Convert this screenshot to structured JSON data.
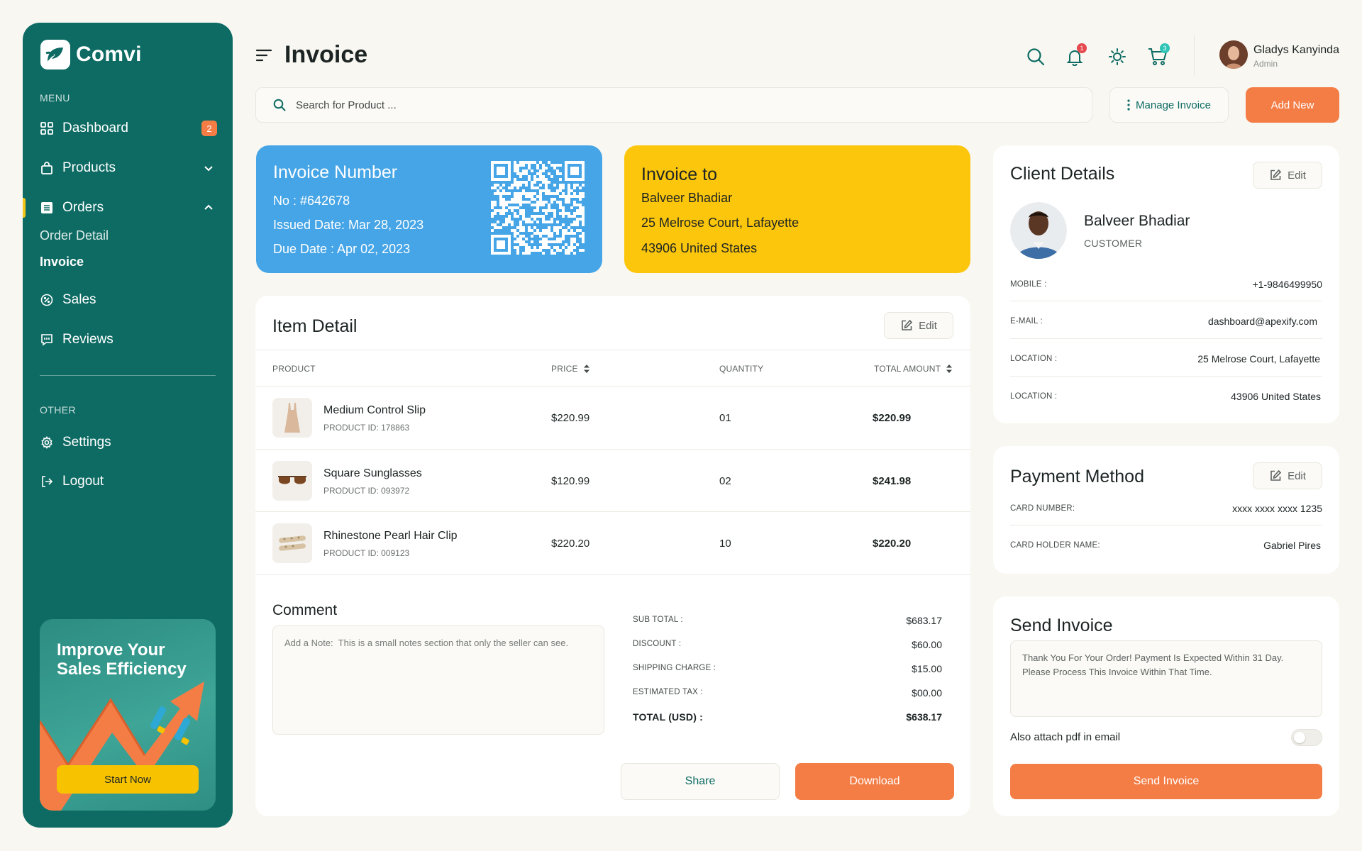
{
  "brand": {
    "name": "Comvi"
  },
  "sidebar": {
    "menu_label": "MENU",
    "other_label": "OTHER",
    "items": [
      {
        "label": "Dashboard",
        "icon": "grid-icon",
        "badge": "2"
      },
      {
        "label": "Products",
        "icon": "shopping-bag-icon"
      },
      {
        "label": "Orders",
        "icon": "list-icon",
        "active": true
      },
      {
        "label": "Sales",
        "icon": "badge-percent-icon"
      },
      {
        "label": "Reviews",
        "icon": "message-icon"
      }
    ],
    "orders_sub": [
      "Order Detail",
      "Invoice"
    ],
    "other_items": [
      {
        "label": "Settings",
        "icon": "gear-icon"
      },
      {
        "label": "Logout",
        "icon": "logout-icon"
      }
    ],
    "promo": {
      "title": "Improve Your Sales Efficiency",
      "button": "Start Now"
    }
  },
  "header": {
    "title": "Invoice",
    "notification_count": "1",
    "cart_count": "3",
    "user": {
      "name": "Gladys Kanyinda",
      "role": "Admin"
    }
  },
  "toolbar": {
    "search_placeholder": "Search for Product ...",
    "manage_label": "Manage Invoice",
    "add_label": "Add New"
  },
  "invoice_number": {
    "title": "Invoice Number",
    "no": "No : #642678",
    "issued": "Issued Date: Mar 28, 2023",
    "due": "Due Date : Apr 02, 2023"
  },
  "invoice_to": {
    "title": "Invoice to",
    "name": "Balveer Bhadiar",
    "address1": "25 Melrose Court, Lafayette",
    "address2": "43906  United States"
  },
  "items": {
    "title": "Item Detail",
    "edit_label": "Edit",
    "columns": [
      "PRODUCT",
      "PRICE",
      "QUANTITY",
      "TOTAL AMOUNT"
    ],
    "rows": [
      {
        "name": "Medium Control Slip",
        "id": "PRODUCT ID: 178863",
        "price": "$220.99",
        "qty": "01",
        "total": "$220.99"
      },
      {
        "name": "Square Sunglasses",
        "id": "PRODUCT ID: 093972",
        "price": "$120.99",
        "qty": "02",
        "total": "$241.98"
      },
      {
        "name": "Rhinestone Pearl Hair Clip",
        "id": "PRODUCT ID: 009123",
        "price": "$220.20",
        "qty": "10",
        "total": "$220.20"
      }
    ]
  },
  "comment": {
    "title": "Comment",
    "placeholder": "Add a Note:  This is a small notes section that only the seller can see."
  },
  "summary": {
    "lines": [
      {
        "label": "SUB TOTAL :",
        "value": "$683.17"
      },
      {
        "label": "DISCOUNT :",
        "value": "$60.00"
      },
      {
        "label": "SHIPPING CHARGE :",
        "value": "$15.00"
      },
      {
        "label": "ESTIMATED TAX :",
        "value": "$00.00"
      }
    ],
    "total_label": "TOTAL (USD) :",
    "total_value": "$638.17",
    "share_label": "Share",
    "download_label": "Download"
  },
  "client": {
    "title": "Client Details",
    "edit_label": "Edit",
    "name": "Balveer Bhadiar",
    "role": "CUSTOMER",
    "fields": [
      {
        "label": "MOBILE :",
        "value": "+1-9846499950"
      },
      {
        "label": "E-MAIL :",
        "value": "dashboard@apexify.com"
      },
      {
        "label": "LOCATION :",
        "value": "25 Melrose Court, Lafayette"
      },
      {
        "label": "LOCATION :",
        "value": "43906  United States"
      }
    ]
  },
  "payment": {
    "title": "Payment Method",
    "edit_label": "Edit",
    "card_number_label": "CARD NUMBER:",
    "card_number": "xxxx xxxx xxxx 1235",
    "holder_label": "CARD HOLDER NAME:",
    "holder": "Gabriel Pires"
  },
  "send": {
    "title": "Send Invoice",
    "message": "Thank You For Your Order! Payment Is Expected Within 31 Day. Please Process This Invoice Within That Time.",
    "attach_label": "Also attach pdf in email",
    "attach_enabled": false,
    "button": "Send Invoice"
  },
  "colors": {
    "sidebar": "#0d6b63",
    "accent": "#f47d46",
    "invoice_number_card": "#46a5e6",
    "invoice_to_card": "#fcc60c",
    "promo_button": "#f7c300"
  }
}
